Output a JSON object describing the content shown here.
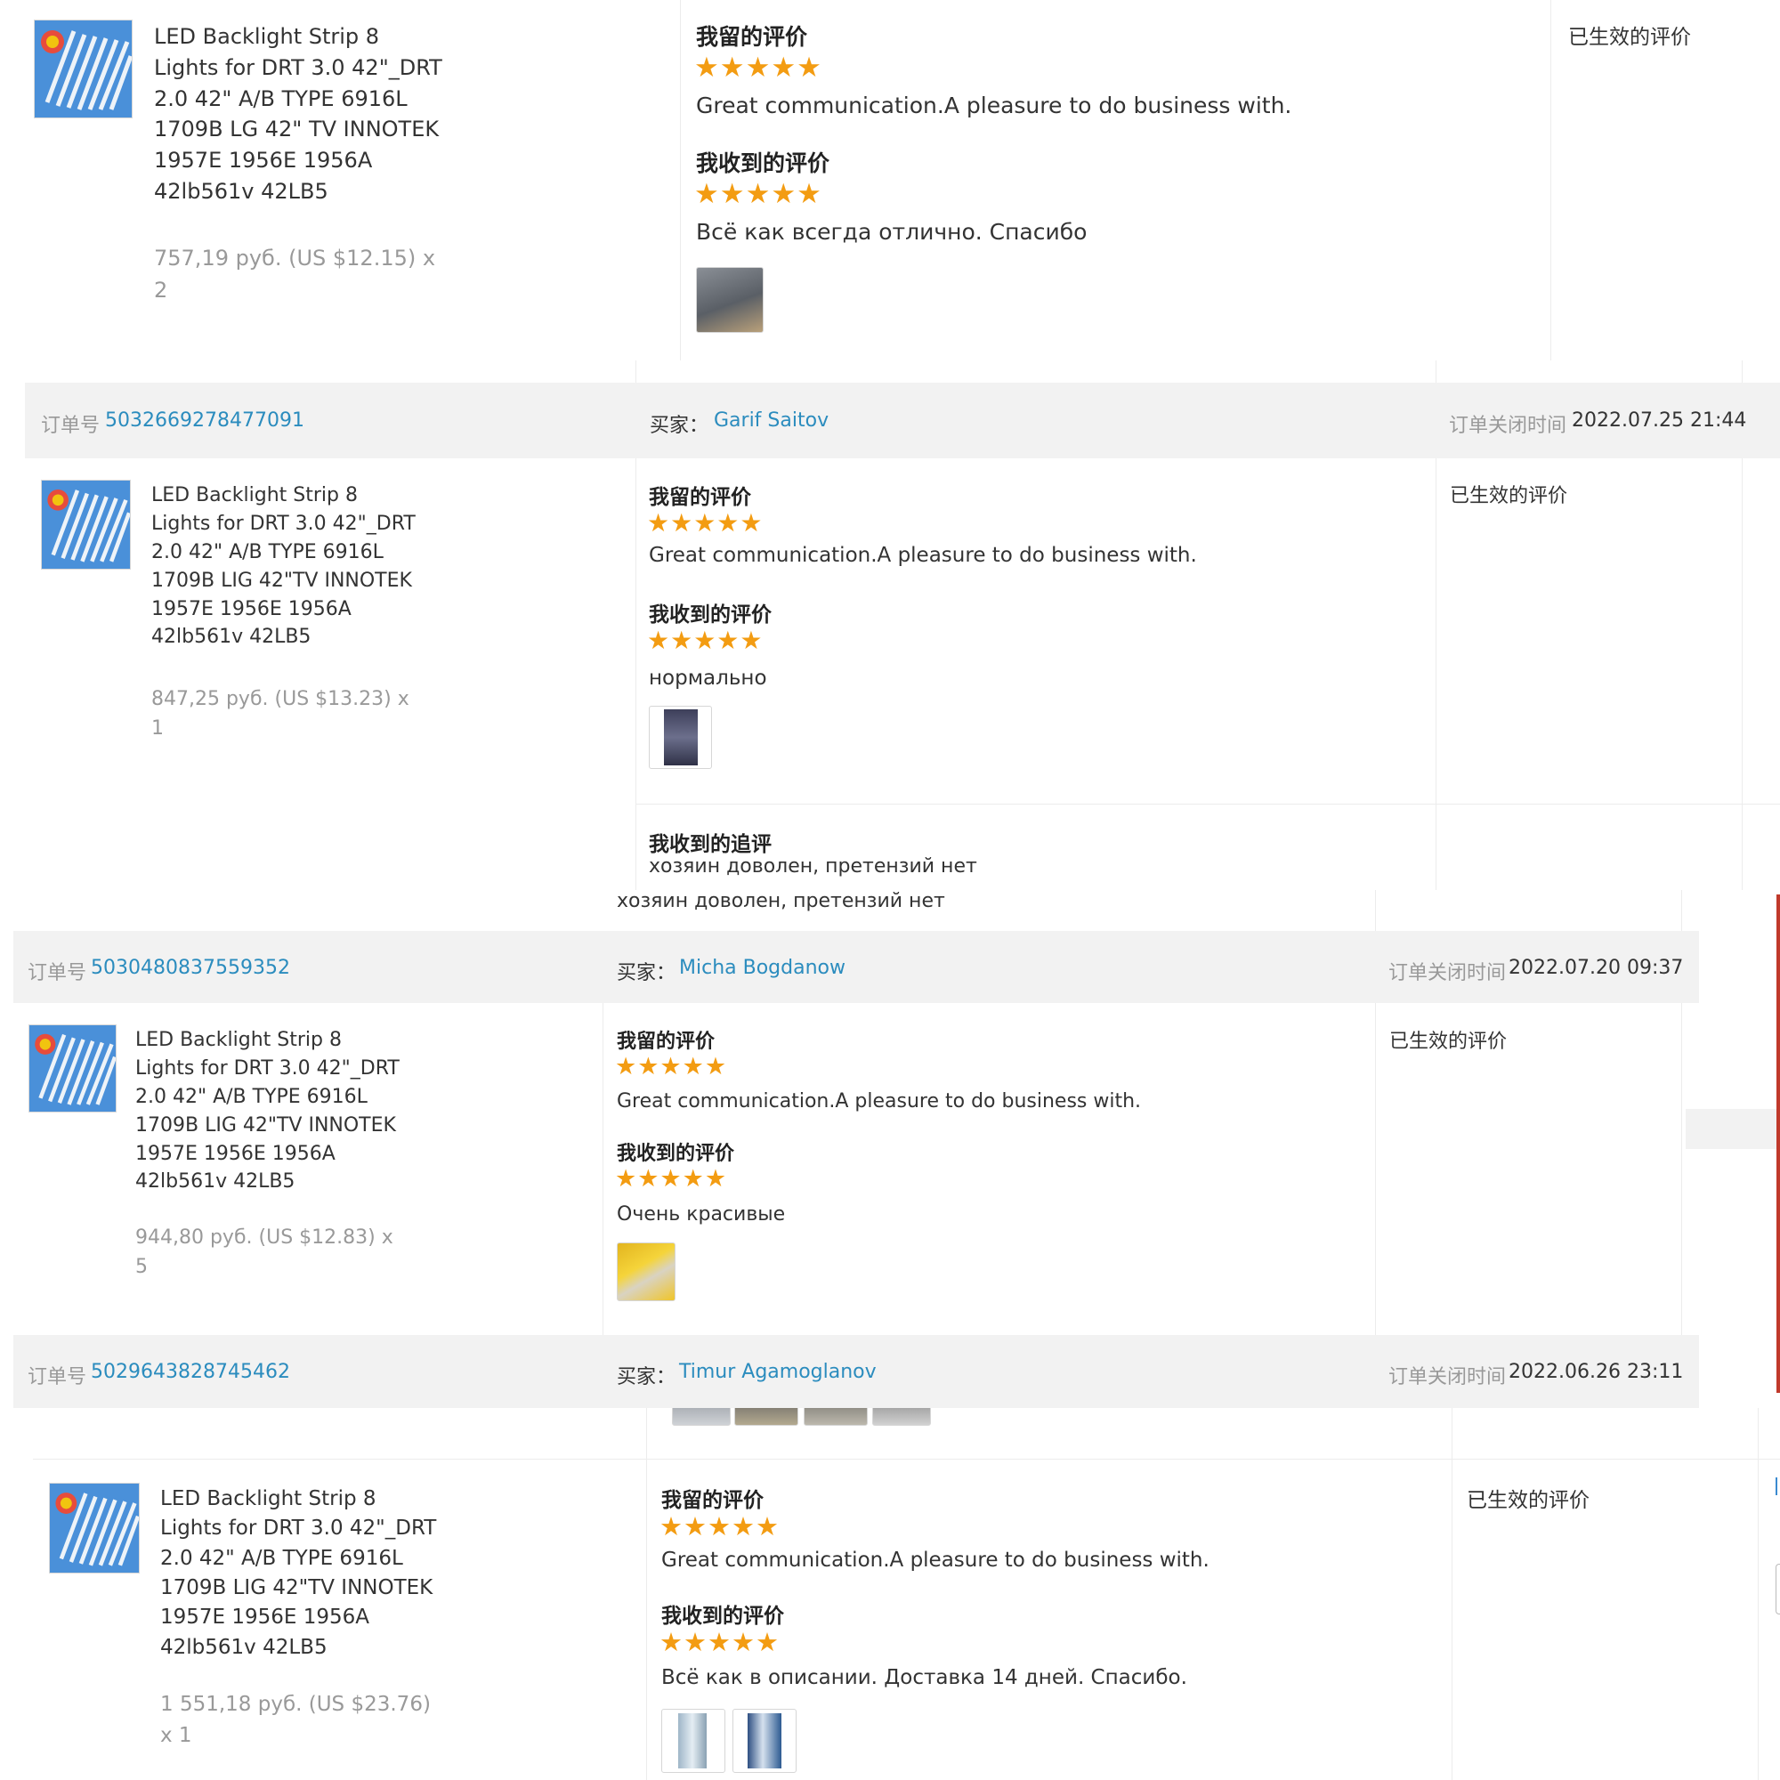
{
  "labels": {
    "order_no": "订单号",
    "buyer": "买家：",
    "close_time": "订单关闭时间",
    "my_review": "我留的评价",
    "received_review": "我收到的评价",
    "received_followup": "我收到的追评",
    "effective_review": "已生效的评价"
  },
  "common": {
    "stars": "★★★★★",
    "my_comment": "Great communication.A pleasure to do business with."
  },
  "block1": {
    "product_lines": [
      "LED Backlight Strip 8",
      "Lights for DRT 3.0 42\"_DRT",
      "2.0 42\" A/B TYPE 6916L",
      "1709B LG 42\" TV INNOTEK",
      "1957E 1956E 1956A",
      "42lb561v 42LB5"
    ],
    "price_lines": [
      "757,19 руб. (US $12.15) x",
      "2"
    ],
    "received_comment": "Всё как всегда отлично. Спасибо"
  },
  "block2": {
    "order_id": "5032669278477091",
    "buyer": "Garif Saitov",
    "close_time": "2022.07.25 21:44",
    "product_lines": [
      "LED Backlight Strip 8",
      "Lights for DRT 3.0 42\"_DRT",
      "2.0 42\" A/B TYPE 6916L",
      "1709B LIG 42\"TV INNOTEK",
      "1957E 1956E 1956A",
      "42lb561v 42LB5"
    ],
    "price_lines": [
      "847,25 руб. (US $13.23) x",
      "1"
    ],
    "received_comment": "нормально",
    "followup": "хозяин доволен, претензий нет"
  },
  "block3": {
    "overflow_followup": "хозяин доволен, претензий нет",
    "order_id": "5030480837559352",
    "buyer": "Micha Bogdanow",
    "close_time": "2022.07.20 09:37",
    "product_lines": [
      "LED Backlight Strip 8",
      "Lights for DRT 3.0 42\"_DRT",
      "2.0 42\" A/B TYPE 6916L",
      "1709B LIG 42\"TV INNOTEK",
      "1957E 1956E 1956A",
      "42lb561v 42LB5"
    ],
    "price_lines": [
      "944,80 руб. (US $12.83) x",
      "5"
    ],
    "received_comment": "Очень красивые"
  },
  "block4": {
    "order_id": "5029643828745462",
    "buyer": "Timur Agamoglanov",
    "close_time": "2022.06.26 23:11"
  },
  "block5": {
    "product_lines": [
      "LED Backlight Strip 8",
      "Lights for DRT 3.0 42\"_DRT",
      "2.0 42\" A/B TYPE 6916L",
      "1709B LIG 42\"TV INNOTEK",
      "1957E 1956E 1956A",
      "42lb561v 42LB5"
    ],
    "price_lines": [
      "1 551,18 руб. (US $23.76)",
      "x 1"
    ],
    "received_comment": "Всё как в описании. Доставка 14 дней. Спасибо."
  }
}
